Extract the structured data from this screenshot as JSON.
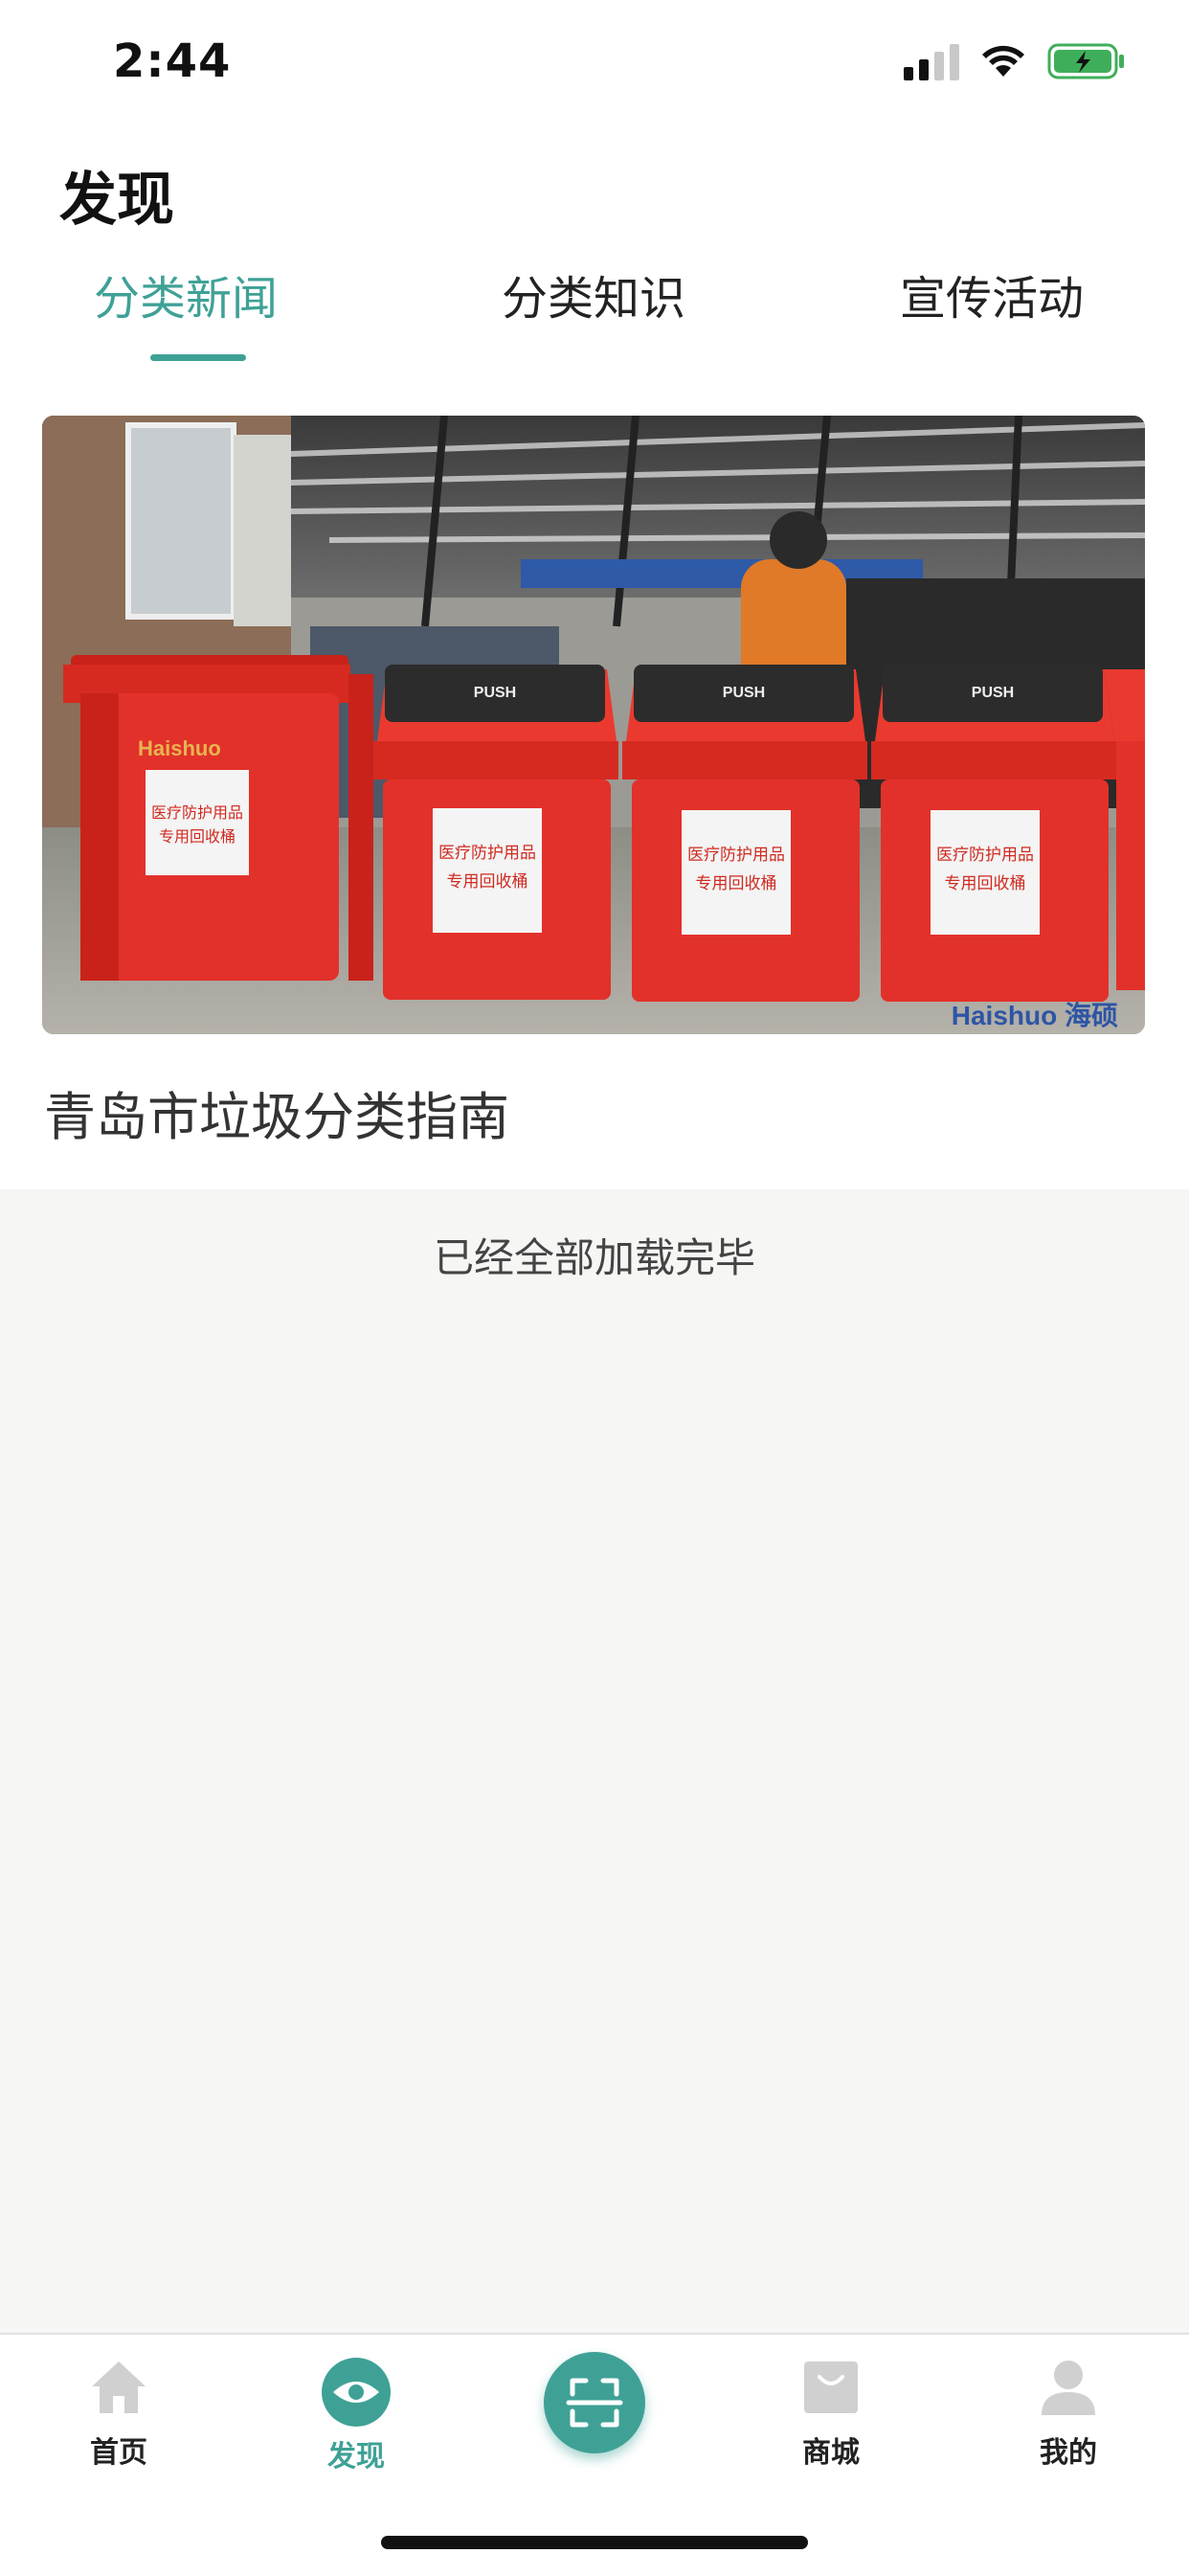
{
  "status_bar": {
    "time": "2:44"
  },
  "header": {
    "title": "发现",
    "tabs": [
      {
        "label": "分类新闻",
        "active": true
      },
      {
        "label": "分类知识",
        "active": false
      },
      {
        "label": "宣传活动",
        "active": false
      }
    ]
  },
  "news": [
    {
      "title": "青岛市垃圾分类指南",
      "image": {
        "bin_label_1": "医疗防护用品",
        "bin_label_2": "专用回收桶",
        "bin_lid_text": "PUSH",
        "brand_text": "Haishuo",
        "watermark": "Haishuo 海硕"
      }
    }
  ],
  "list_footer": "已经全部加载完毕",
  "tabbar": {
    "items": [
      {
        "label": "首页",
        "icon": "home-icon",
        "active": false
      },
      {
        "label": "发现",
        "icon": "eye-icon",
        "active": true
      },
      {
        "label": "",
        "icon": "scan-icon",
        "active": false
      },
      {
        "label": "商城",
        "icon": "shopping-bag-icon",
        "active": false
      },
      {
        "label": "我的",
        "icon": "user-icon",
        "active": false
      }
    ]
  },
  "colors": {
    "accent": "#3fa196",
    "bin_red": "#e02a20",
    "background": "#f6f6f4"
  }
}
